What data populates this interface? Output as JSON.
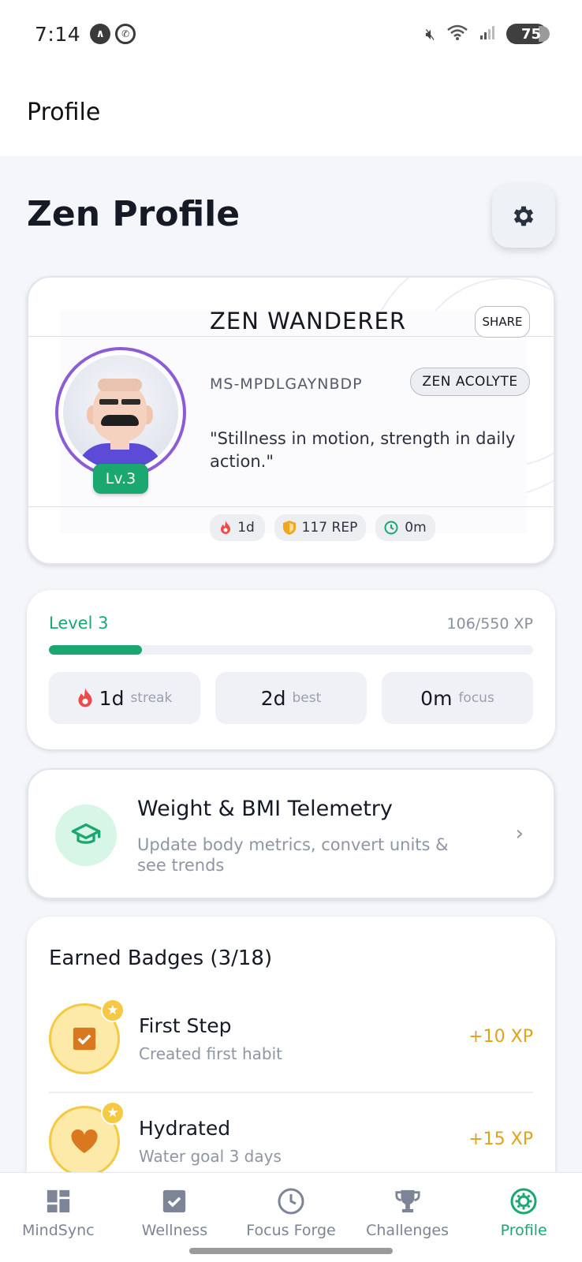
{
  "status_bar": {
    "time": "7:14",
    "battery": "75"
  },
  "app_bar": {
    "title": "Profile"
  },
  "header": {
    "title": "Zen Profile"
  },
  "profile": {
    "name": "ZEN WANDERER",
    "share_label": "SHARE",
    "user_id": "MS-MPDLGAYNBDP",
    "rank": "ZEN ACOLYTE",
    "quote": "\"Stillness in motion, strength in daily action.\"",
    "level_badge": "Lv.3",
    "avatar_border_color": "#8b5cd6",
    "stats": [
      {
        "icon": "flame-icon",
        "value": "1d"
      },
      {
        "icon": "shield-icon",
        "value": "117 REP"
      },
      {
        "icon": "clock-icon",
        "value": "0m"
      }
    ]
  },
  "level": {
    "label": "Level 3",
    "xp_text": "106/550 XP",
    "xp_current": 106,
    "xp_total": 550,
    "accent": "#1aa870",
    "stats": [
      {
        "value": "1d",
        "label": "streak",
        "icon": "flame-icon"
      },
      {
        "value": "2d",
        "label": "best"
      },
      {
        "value": "0m",
        "label": "focus"
      }
    ]
  },
  "bmi": {
    "icon": "graduation-cap-icon",
    "title": "Weight & BMI Telemetry",
    "subtitle": "Update body metrics, convert units & see trends"
  },
  "badges": {
    "title": "Earned Badges (3/18)",
    "items": [
      {
        "icon": "checkbox-icon",
        "name": "First Step",
        "desc": "Created first habit",
        "xp": "+10 XP"
      },
      {
        "icon": "heart-icon",
        "name": "Hydrated",
        "desc": "Water goal 3 days",
        "xp": "+15 XP"
      }
    ]
  },
  "nav": {
    "items": [
      {
        "label": "MindSync",
        "icon": "dashboard-icon"
      },
      {
        "label": "Wellness",
        "icon": "checkbox-icon"
      },
      {
        "label": "Focus Forge",
        "icon": "clock-icon"
      },
      {
        "label": "Challenges",
        "icon": "trophy-icon"
      },
      {
        "label": "Profile",
        "icon": "profile-gear-icon",
        "active": true
      }
    ]
  }
}
